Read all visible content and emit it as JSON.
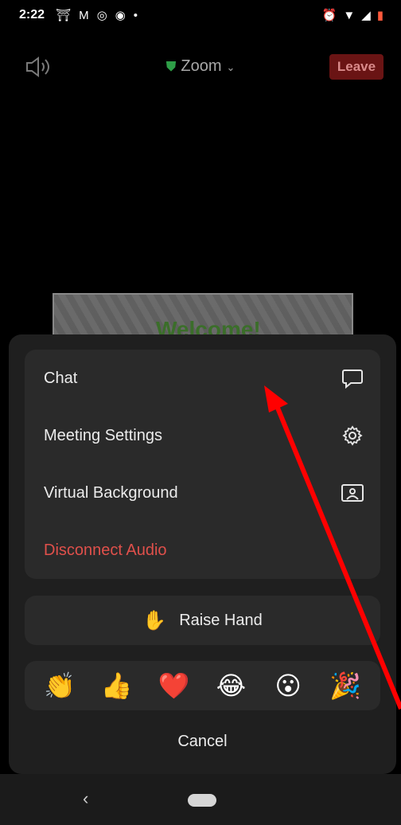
{
  "status_bar": {
    "time": "2:22",
    "left_icons": [
      "notification-icon",
      "gmail-icon",
      "instagram-icon",
      "shazam-icon",
      "dot-icon"
    ],
    "right_icons": [
      "alarm-icon",
      "wifi-icon",
      "signal-icon",
      "battery-icon"
    ]
  },
  "meeting": {
    "title": "Zoom",
    "leave_label": "Leave",
    "shared_text": "Welcome!"
  },
  "menu": {
    "items": [
      {
        "label": "Chat",
        "icon": "chat-bubble-icon"
      },
      {
        "label": "Meeting Settings",
        "icon": "gear-icon"
      },
      {
        "label": "Virtual Background",
        "icon": "person-frame-icon"
      },
      {
        "label": "Disconnect Audio",
        "icon": ""
      }
    ]
  },
  "raise_hand": {
    "label": "Raise Hand",
    "emoji": "✋"
  },
  "reactions": [
    "👏",
    "👍",
    "❤️",
    "😂",
    "😮",
    "🎉"
  ],
  "cancel_label": "Cancel",
  "colors": {
    "danger": "#e0504b",
    "leave_bg": "#6a1414",
    "sheet_bg": "#1f1f1f",
    "card_bg": "#2a2a2a",
    "annotation_arrow": "#ff0000"
  }
}
